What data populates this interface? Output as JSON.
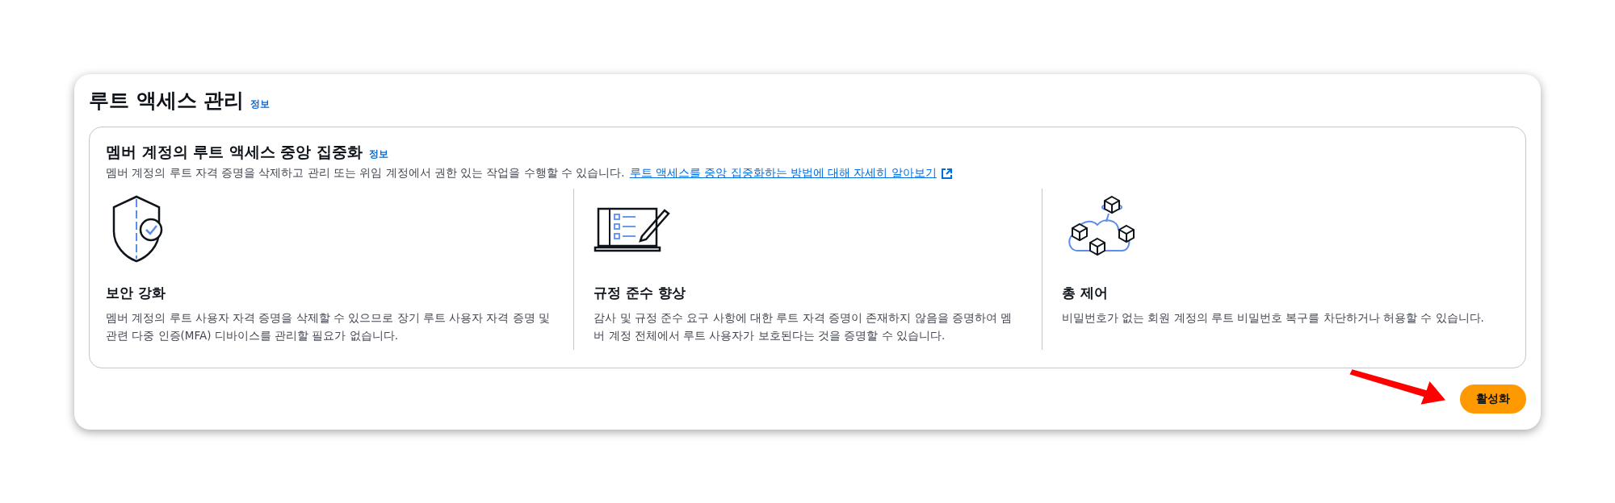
{
  "panel": {
    "title": "루트 액세스 관리",
    "info_link": "정보"
  },
  "section": {
    "title": "멤버 계정의 루트 액세스 중앙 집중화",
    "info_link": "정보",
    "description": "멤버 계정의 루트 자격 증명을 삭제하고 관리 또는 위임 계정에서 권한 있는 작업을 수행할 수 있습니다.",
    "learn_more_link": "루트 액세스를 중앙 집중화하는 방법에 대해 자세히 알아보기",
    "features": [
      {
        "kind": "shield",
        "title": "보안 강화",
        "text": "멤버 계정의 루트 사용자 자격 증명을 삭제할 수 있으므로 장기 루트 사용자 자격 증명 및 관련 다중 인증(MFA) 디바이스를 관리할 필요가 없습니다."
      },
      {
        "kind": "checklist",
        "title": "규정 준수 향상",
        "text": "감사 및 규정 준수 요구 사항에 대한 루트 자격 증명이 존재하지 않음을 증명하여 멤버 계정 전체에서 루트 사용자가 보호된다는 것을 증명할 수 있습니다."
      },
      {
        "kind": "cubes",
        "title": "총 제어",
        "text": "비밀번호가 없는 회원 계정의 루트 비밀번호 복구를 차단하거나 허용할 수 있습니다."
      }
    ]
  },
  "primary_button": "활성화"
}
